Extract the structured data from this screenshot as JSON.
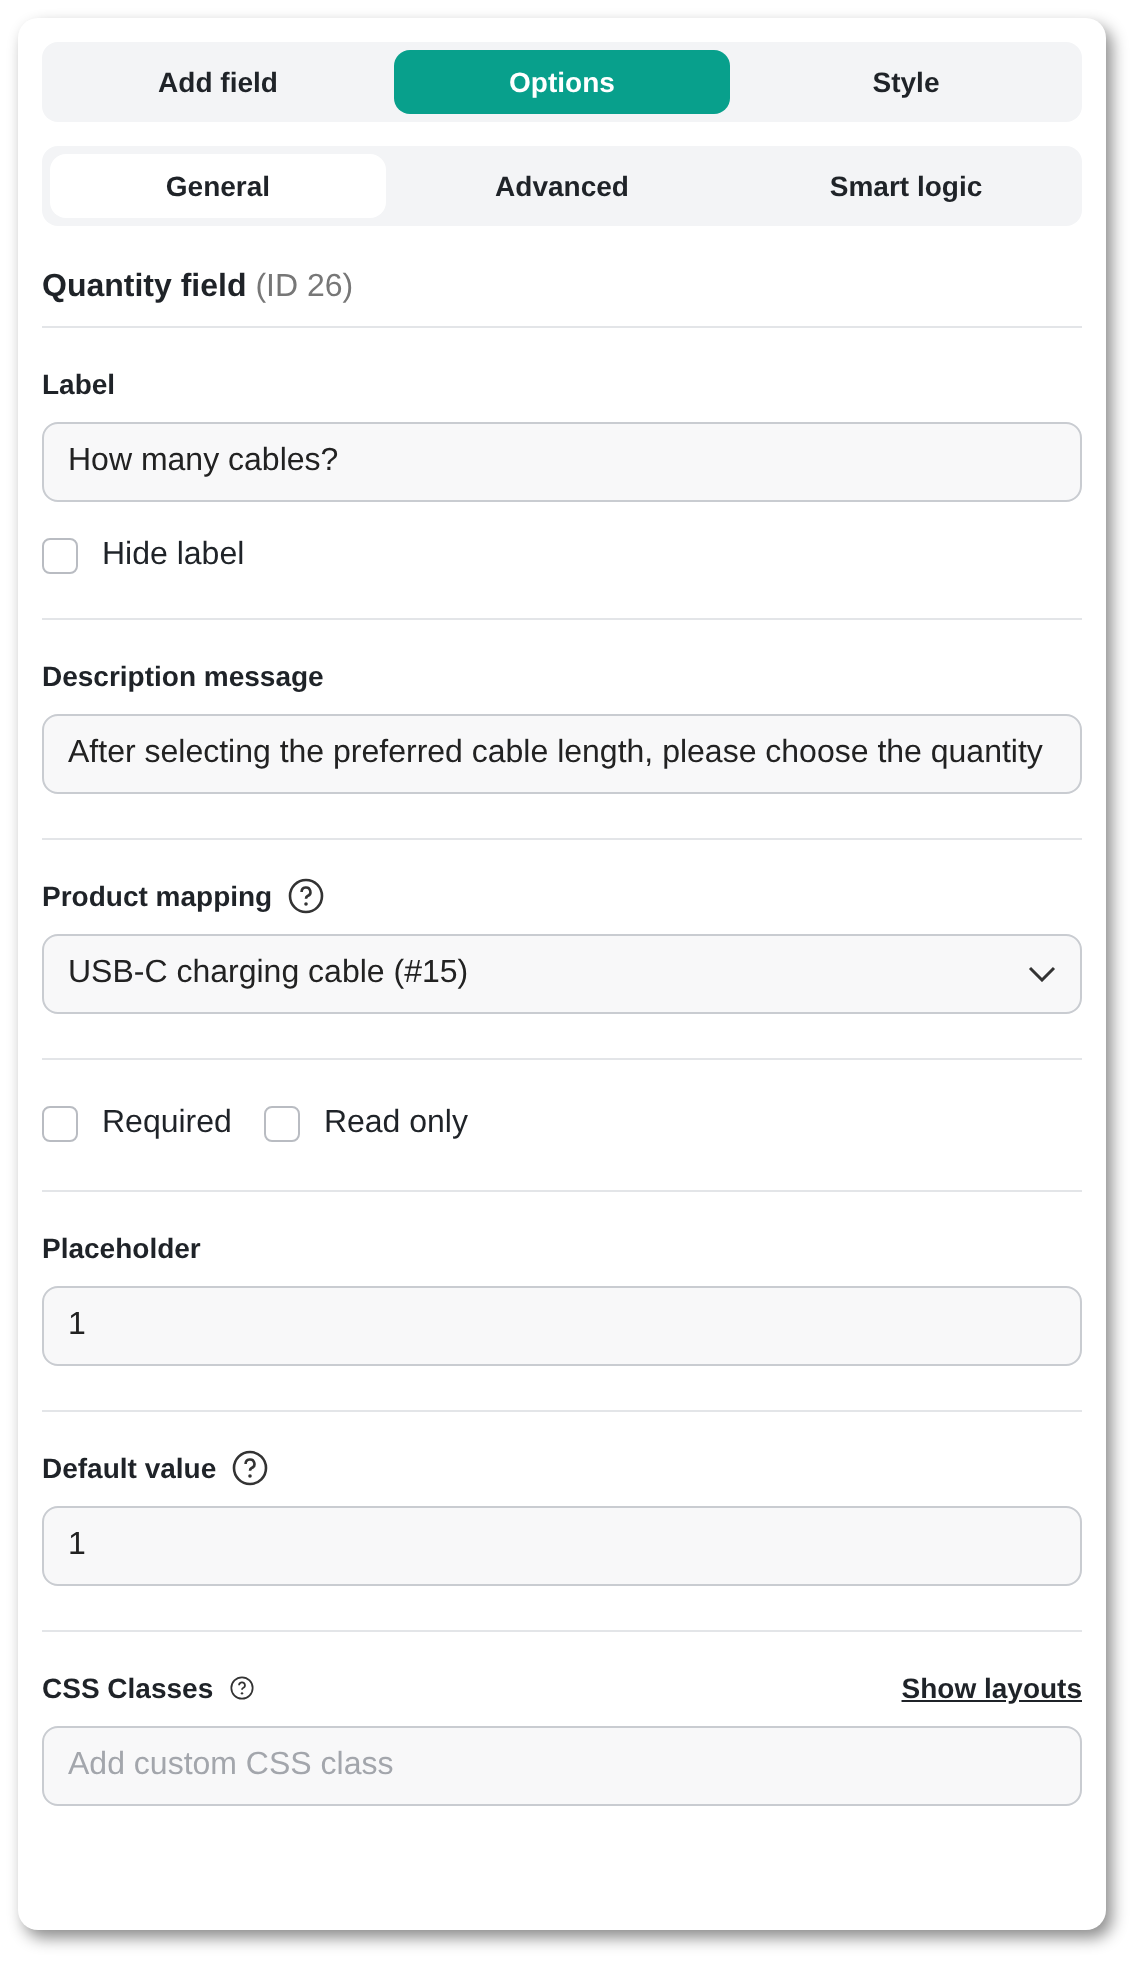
{
  "tabs": [
    {
      "label": "Add field",
      "selected": false
    },
    {
      "label": "Options",
      "selected": true
    },
    {
      "label": "Style",
      "selected": false
    }
  ],
  "subtabs": [
    {
      "label": "General",
      "selected": true
    },
    {
      "label": "Advanced",
      "selected": false
    },
    {
      "label": "Smart logic",
      "selected": false
    }
  ],
  "field_title": {
    "name": "Quantity field",
    "id": "(ID 26)"
  },
  "sections": [
    {
      "kind": "input",
      "label": "Label",
      "value": "How many cables?",
      "options": [
        {
          "label": "Hide label",
          "checked": false
        }
      ]
    },
    {
      "kind": "input",
      "label": "Description message",
      "value": "After selecting the preferred cable length, please choose the quantity"
    },
    {
      "kind": "select",
      "label": "Product mapping",
      "help": true,
      "value": "USB-C charging cable (#15)"
    },
    {
      "kind": "checkboxes",
      "options": [
        {
          "label": "Required",
          "checked": false
        },
        {
          "label": "Read only",
          "checked": false
        }
      ]
    },
    {
      "kind": "input",
      "label": "Placeholder",
      "value": "1"
    },
    {
      "kind": "input",
      "label": "Default value",
      "help": true,
      "value": "1"
    },
    {
      "kind": "input",
      "label": "CSS Classes",
      "help": true,
      "help_small": true,
      "link": "Show layouts",
      "placeholder": "Add custom CSS class"
    }
  ]
}
